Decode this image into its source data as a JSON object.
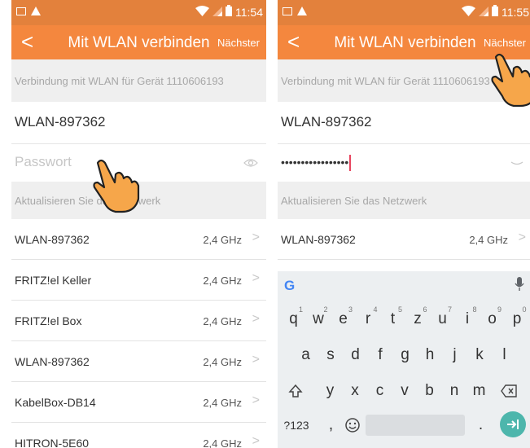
{
  "screens": [
    {
      "status": {
        "time": "11:54"
      },
      "appbar": {
        "title": "Mit WLAN verbinden",
        "next": "Nächster"
      },
      "info": "Verbindung mit WLAN für Gerät 1110606193",
      "ssid": "WLAN-897362",
      "password": {
        "placeholder": "Passwort",
        "masked": ""
      },
      "section": "Aktualisieren Sie das Netzwerk",
      "networks": [
        {
          "name": "WLAN-897362",
          "freq": "2,4 GHz"
        },
        {
          "name": "FRITZ!el Keller",
          "freq": "2,4 GHz"
        },
        {
          "name": "FRITZ!el Box",
          "freq": "2,4 GHz"
        },
        {
          "name": "WLAN-897362",
          "freq": "2,4 GHz"
        },
        {
          "name": "KabelBox-DB14",
          "freq": "2,4 GHz"
        },
        {
          "name": "HITRON-5E60",
          "freq": "2,4 GHz"
        }
      ]
    },
    {
      "status": {
        "time": "11:55"
      },
      "appbar": {
        "title": "Mit WLAN verbinden",
        "next": "Nächster"
      },
      "info": "Verbindung mit WLAN für Gerät 1110606193",
      "ssid": "WLAN-897362",
      "password": {
        "placeholder": "",
        "masked": "•••••••••••••••••"
      },
      "section": "Aktualisieren Sie das Netzwerk",
      "networks": [
        {
          "name": "WLAN-897362",
          "freq": "2,4 GHz"
        }
      ]
    }
  ],
  "keyboard": {
    "row1": [
      "q",
      "w",
      "e",
      "r",
      "t",
      "z",
      "u",
      "i",
      "o",
      "p"
    ],
    "row1_hints": [
      "1",
      "2",
      "3",
      "4",
      "5",
      "6",
      "7",
      "8",
      "9",
      "0"
    ],
    "row2": [
      "a",
      "s",
      "d",
      "f",
      "g",
      "h",
      "j",
      "k",
      "l"
    ],
    "row3": [
      "y",
      "x",
      "c",
      "v",
      "b",
      "n",
      "m"
    ],
    "symbols_label": "?123",
    "comma": ",",
    "period": "."
  },
  "colors": {
    "accent": "#f4873e",
    "status_bar": "#e3813c",
    "enter_key": "#4db6ac"
  }
}
